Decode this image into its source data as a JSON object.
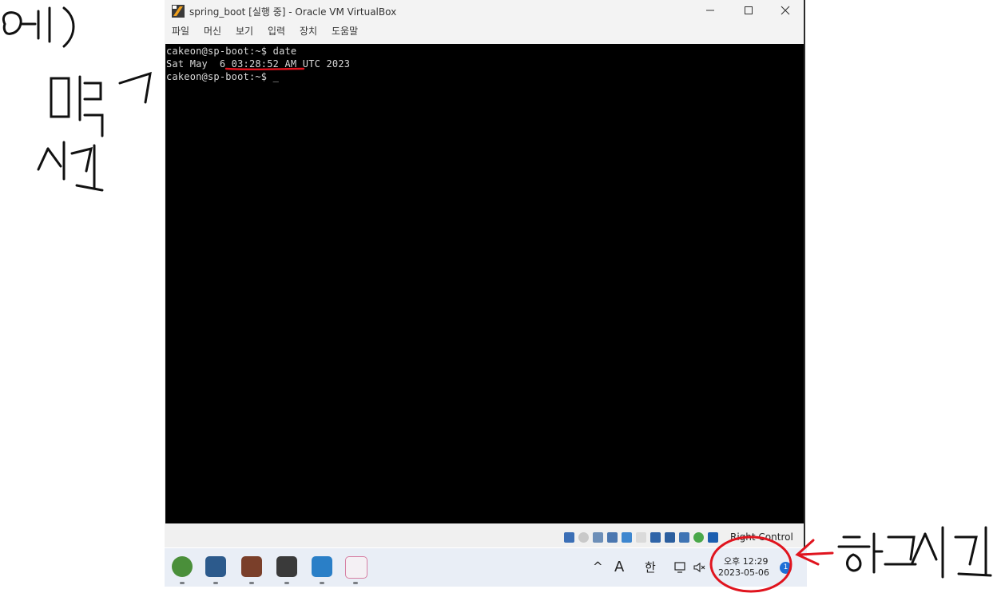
{
  "window": {
    "title": "spring_boot [실행 중] - Oracle VM VirtualBox",
    "minimize_icon": "minimize-icon",
    "maximize_icon": "maximize-icon",
    "close_icon": "close-icon"
  },
  "menu": {
    "items": [
      "파일",
      "머신",
      "보기",
      "입력",
      "장치",
      "도움말"
    ]
  },
  "terminal": {
    "lines": [
      "cakeon@sp-boot:~$ date",
      "Sat May  6 03:28:52 AM UTC 2023",
      "cakeon@sp-boot:~$ _"
    ]
  },
  "statusbar": {
    "host_key": "Right Control",
    "icons": [
      "hard-disk-icon",
      "optical-drive-icon",
      "audio-icon",
      "network-icon",
      "usb-icon",
      "shared-folders-icon",
      "display-icon",
      "recording-icon",
      "cpu-icon",
      "mouse-integration-icon",
      "keyboard-icon"
    ]
  },
  "taskbar": {
    "apps": [
      "hs-app-icon",
      "virtualbox-icon",
      "app-icon-3",
      "app-icon-4",
      "notepad-icon",
      "snipping-tool-icon"
    ],
    "tray_chevron": "^",
    "input_mode_a": "A",
    "input_mode_han": "한",
    "clock_time": "오후 12:29",
    "clock_date": "2023-05-06",
    "notification_count": "1"
  },
  "colors": {
    "annotation_ink": "#e0141e",
    "handwriting_ink": "#111111",
    "terminal_bg": "#000000",
    "terminal_fg": "#d8d8d8"
  },
  "annotations": {
    "handwritten_note_left": "예) 미국 → 시간",
    "handwritten_note_right": "← 한국시간"
  }
}
